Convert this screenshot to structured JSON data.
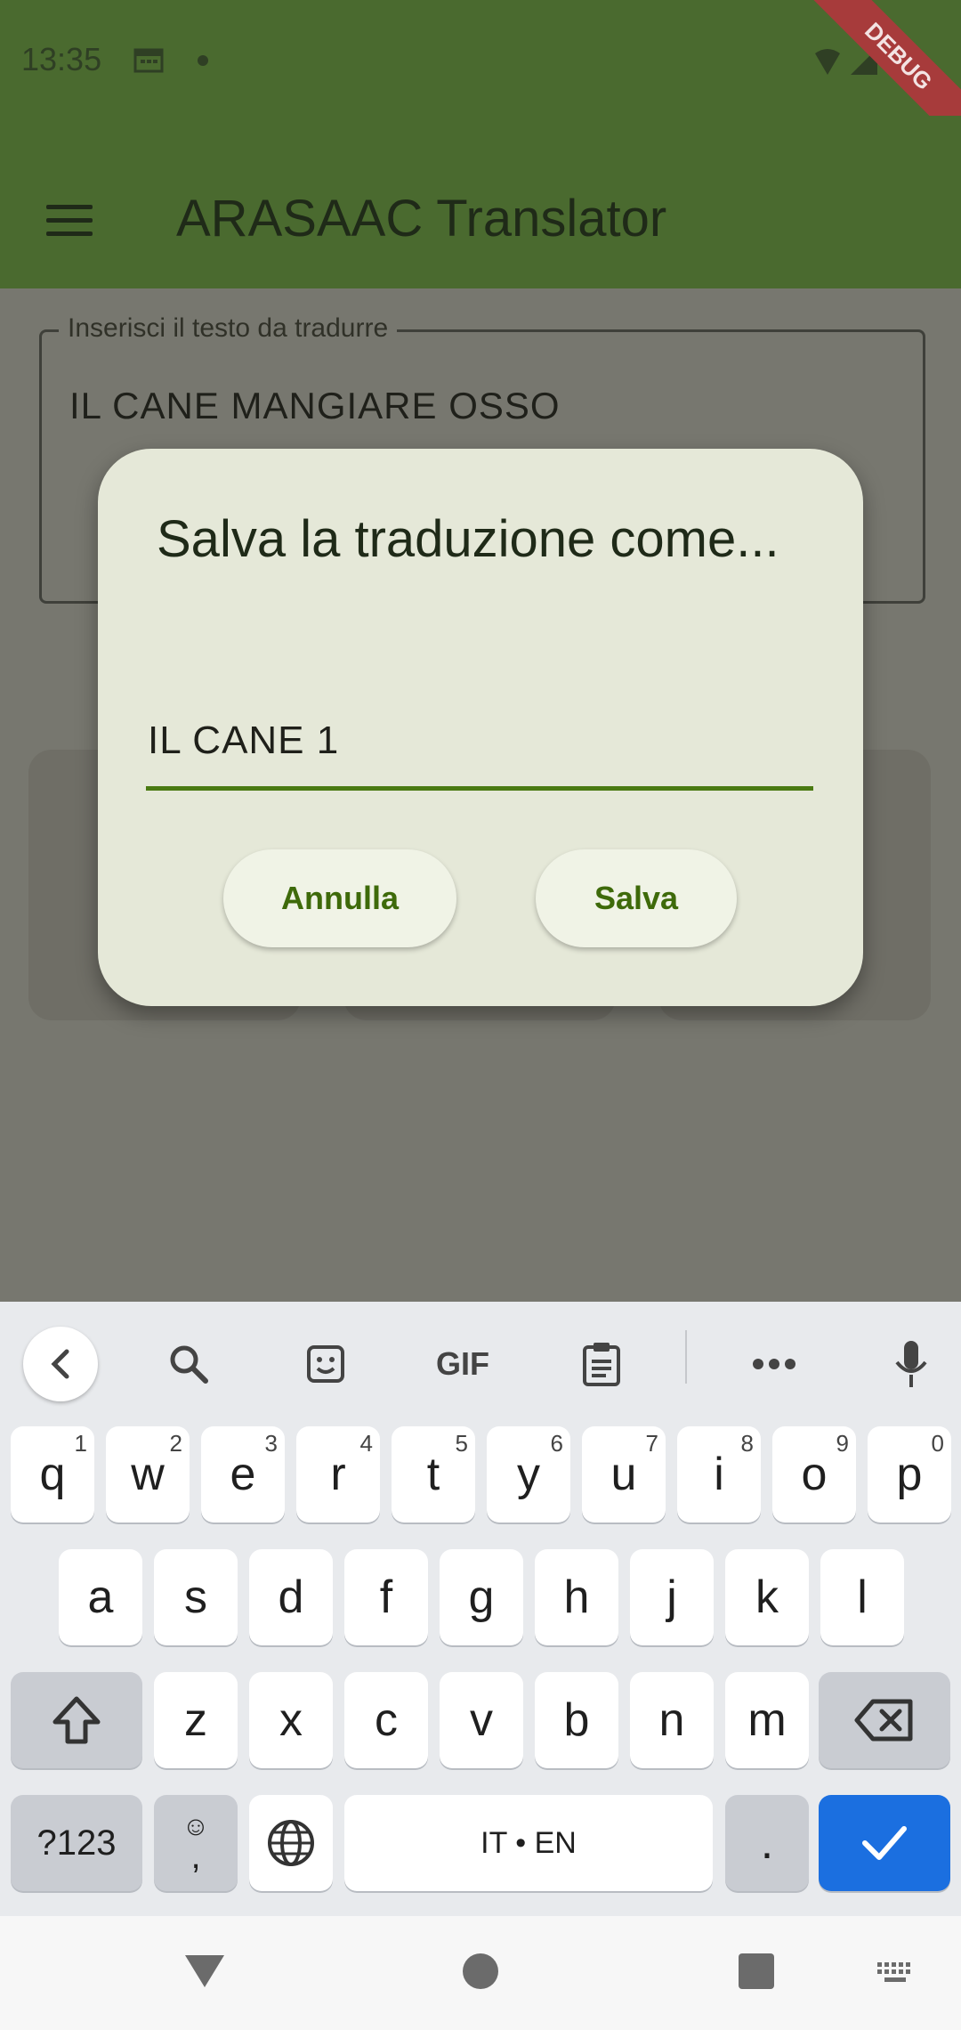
{
  "status_bar": {
    "time": "13:35"
  },
  "debug_banner": "DEBUG",
  "app_bar": {
    "title": "ARASAAC Translator"
  },
  "translation_field": {
    "label": "Inserisci il testo da tradurre",
    "value": "IL CANE MANGIARE OSSO"
  },
  "dialog": {
    "title": "Salva la traduzione come...",
    "input_value": "IL CANE 1",
    "cancel_label": "Annulla",
    "save_label": "Salva"
  },
  "keyboard": {
    "row1": [
      {
        "k": "q",
        "n": "1"
      },
      {
        "k": "w",
        "n": "2"
      },
      {
        "k": "e",
        "n": "3"
      },
      {
        "k": "r",
        "n": "4"
      },
      {
        "k": "t",
        "n": "5"
      },
      {
        "k": "y",
        "n": "6"
      },
      {
        "k": "u",
        "n": "7"
      },
      {
        "k": "i",
        "n": "8"
      },
      {
        "k": "o",
        "n": "9"
      },
      {
        "k": "p",
        "n": "0"
      }
    ],
    "row2": [
      "a",
      "s",
      "d",
      "f",
      "g",
      "h",
      "j",
      "k",
      "l"
    ],
    "row3": [
      "z",
      "x",
      "c",
      "v",
      "b",
      "n",
      "m"
    ],
    "symbols_label": "?123",
    "emoji_comma": ",",
    "space_label": "IT • EN",
    "period_label": ".",
    "toolbar_gif": "GIF"
  },
  "colors": {
    "accent": "#4a7a12",
    "app_bar_dimmed": "#4a6a2f",
    "enter_key": "#1b6fe0"
  }
}
